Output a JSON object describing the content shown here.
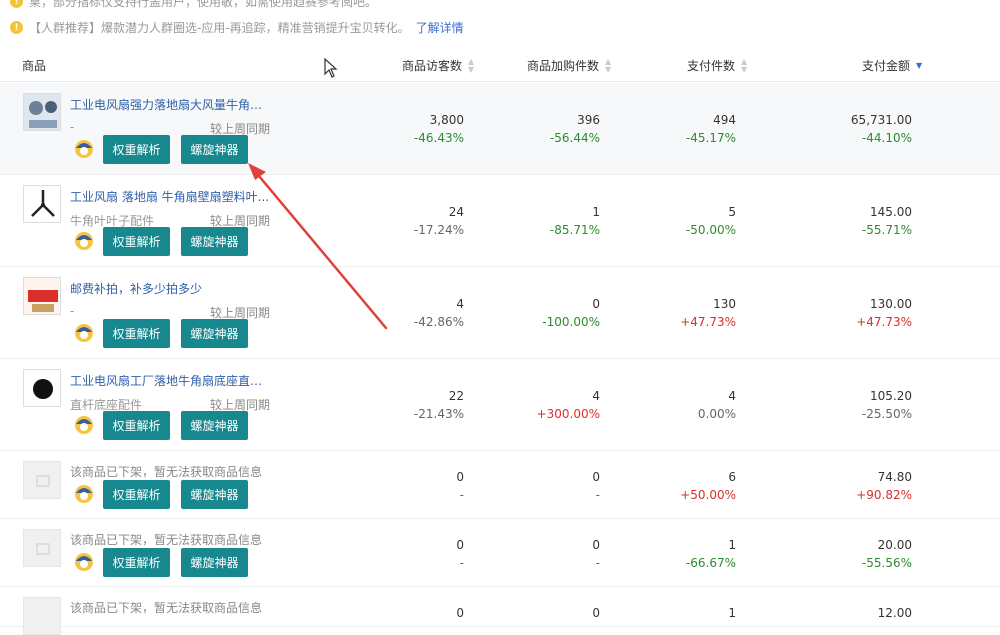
{
  "notices": [
    {
      "text": "桌，部分指标仅支持行盖用户，使用敏，如需使用趋赛参考阅吧。",
      "link": ""
    },
    {
      "text": "【人群推荐】爆款潜力人群圈选-应用-再追踪，精准营销提升宝贝转化。",
      "link": "了解详情"
    }
  ],
  "colors": {
    "accent": "#17888e",
    "link": "#2f5fa8",
    "up": "#d9302b",
    "down": "#2e8b2e",
    "annotation": "#e0413b"
  },
  "table": {
    "headers": {
      "product": "商品",
      "visitors": "商品访客数",
      "cart": "商品加购件数",
      "paid_items": "支付件数",
      "paid_amount": "支付金额"
    },
    "action_labels": {
      "weight": "权重解析",
      "spiral": "螺旋神器"
    },
    "rows": [
      {
        "title": "工业电风扇强力落地扇大风量牛角扇...",
        "sub": "-",
        "compare": "较上周同期",
        "visitors": "3,800",
        "visitors_pct": "-46.43%",
        "cart": "396",
        "cart_pct": "-56.44%",
        "paid_items": "494",
        "paid_items_pct": "-45.17%",
        "paid_amount": "65,731.00",
        "paid_amount_pct": "-44.10%"
      },
      {
        "title": "工业风扇 落地扇 牛角扇壁扇塑料叶...",
        "sub": "牛角叶叶子配件",
        "compare": "较上周同期",
        "visitors": "24",
        "visitors_pct": "-17.24%",
        "cart": "1",
        "cart_pct": "-85.71%",
        "paid_items": "5",
        "paid_items_pct": "-50.00%",
        "paid_amount": "145.00",
        "paid_amount_pct": "-55.71%"
      },
      {
        "title": "邮费补拍，补多少拍多少",
        "sub": "-",
        "compare": "较上周同期",
        "visitors": "4",
        "visitors_pct": "-42.86%",
        "cart": "0",
        "cart_pct": "-100.00%",
        "paid_items": "130",
        "paid_items_pct": "+47.73%",
        "paid_amount": "130.00",
        "paid_amount_pct": "+47.73%"
      },
      {
        "title": "工业电风扇工厂落地牛角扇底座直杆...",
        "sub": "直杆底座配件",
        "compare": "较上周同期",
        "visitors": "22",
        "visitors_pct": "-21.43%",
        "cart": "4",
        "cart_pct": "+300.00%",
        "paid_items": "4",
        "paid_items_pct": "0.00%",
        "paid_amount": "105.20",
        "paid_amount_pct": "-25.50%"
      },
      {
        "title": "该商品已下架，暂无法获取商品信息",
        "sub": "",
        "compare": "",
        "visitors": "0",
        "visitors_pct": "-",
        "cart": "0",
        "cart_pct": "-",
        "paid_items": "6",
        "paid_items_pct": "+50.00%",
        "paid_amount": "74.80",
        "paid_amount_pct": "+90.82%"
      },
      {
        "title": "该商品已下架，暂无法获取商品信息",
        "sub": "",
        "compare": "",
        "visitors": "0",
        "visitors_pct": "-",
        "cart": "0",
        "cart_pct": "-",
        "paid_items": "1",
        "paid_items_pct": "-66.67%",
        "paid_amount": "20.00",
        "paid_amount_pct": "-55.56%"
      },
      {
        "title": "该商品已下架，暂无法获取商品信息",
        "sub": "",
        "compare": "",
        "visitors": "0",
        "visitors_pct": "",
        "cart": "0",
        "cart_pct": "",
        "paid_items": "1",
        "paid_items_pct": "",
        "paid_amount": "12.00",
        "paid_amount_pct": ""
      }
    ]
  }
}
